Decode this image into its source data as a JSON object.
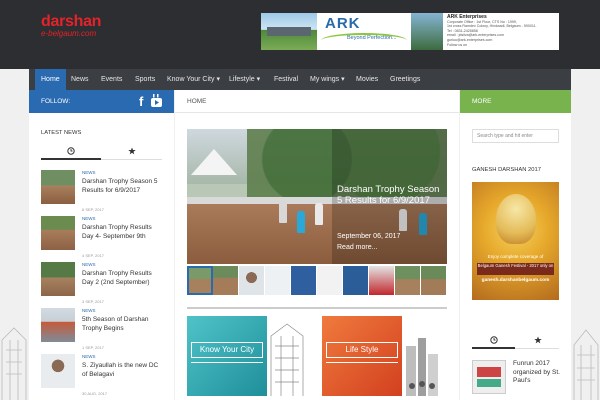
{
  "header": {
    "logo_main": "darshan",
    "logo_sub": "e-belgaum.com",
    "banner": {
      "brand": "ARK",
      "tagline": "Beyond Perfection...",
      "company": "ARK Enterprises",
      "lines": [
        "Corporate Office : 1st Floor, CTS No : 1999,",
        "1st cross Ramdev Colony, Hindwadi, Belgaum - 590011.",
        "Tel : 0831-2425858",
        "email : jdsilva@ark-enterprises.com",
        "guriuu@ark-enterprises.com",
        "Follow us on"
      ]
    }
  },
  "nav": {
    "items": [
      {
        "label": "Home",
        "active": true
      },
      {
        "label": "News"
      },
      {
        "label": "Events"
      },
      {
        "label": "Sports"
      },
      {
        "label": "Know Your City",
        "dropdown": true
      },
      {
        "label": "Lifestyle",
        "dropdown": true
      },
      {
        "label": "Festival"
      },
      {
        "label": "My wings",
        "dropdown": true
      },
      {
        "label": "Movies"
      },
      {
        "label": "Greetings"
      }
    ],
    "caret": "▾"
  },
  "left": {
    "follow_label": "FOLLOW:",
    "facebook_glyph": "f",
    "latest_title": "LATEST NEWS",
    "tab_recent_icon": "clock-icon",
    "tab_popular_icon": "star-icon",
    "news": [
      {
        "cat": "NEWS",
        "title": "Darshan Trophy Season 5 Results for 6/9/2017",
        "date": "6 SEP, 2017"
      },
      {
        "cat": "NEWS",
        "title": "Darshan Trophy Results Day 4- September 9th",
        "date": "4 SEP, 2017"
      },
      {
        "cat": "NEWS",
        "title": "Darshan Trophy Results Day 2 (2nd September)",
        "date": "3 SEP, 2017"
      },
      {
        "cat": "NEWS",
        "title": "5th Season of Darshan Trophy Begins",
        "date": "1 SEP, 2017"
      },
      {
        "cat": "NEWS",
        "title": "S. Ziyaullah is the new DC of Belagavi",
        "date": "30 AUG, 2017"
      }
    ]
  },
  "main": {
    "breadcrumb": "HOME",
    "slide": {
      "title": "Darshan Trophy Season 5 Results for 6/9/2017",
      "date": "September 06, 2017",
      "more": "Read more..."
    },
    "cards": [
      {
        "label": "Know Your City",
        "color": "#2aa9b3"
      },
      {
        "label": "Life  Style",
        "color": "#e2502b"
      }
    ]
  },
  "right": {
    "more_label": "MORE",
    "search_placeholder": "Search type and hit enter",
    "ganesh_title": "GANESH DARSHAN 2017",
    "ganesh_text1": "Enjoy complete coverage of",
    "ganesh_text2": "Belgaum Ganesh Festival - 2017 only on",
    "ganesh_text3": "ganesh.darshanbelgaum.com",
    "news_title": "Funrun 2017 organized by St. Paul's"
  },
  "colors": {
    "accent_blue": "#2a6ab0",
    "accent_green": "#78b34e",
    "logo_red": "#e4232a",
    "topbar": "#2c2e31",
    "nav": "#3b3e43"
  }
}
